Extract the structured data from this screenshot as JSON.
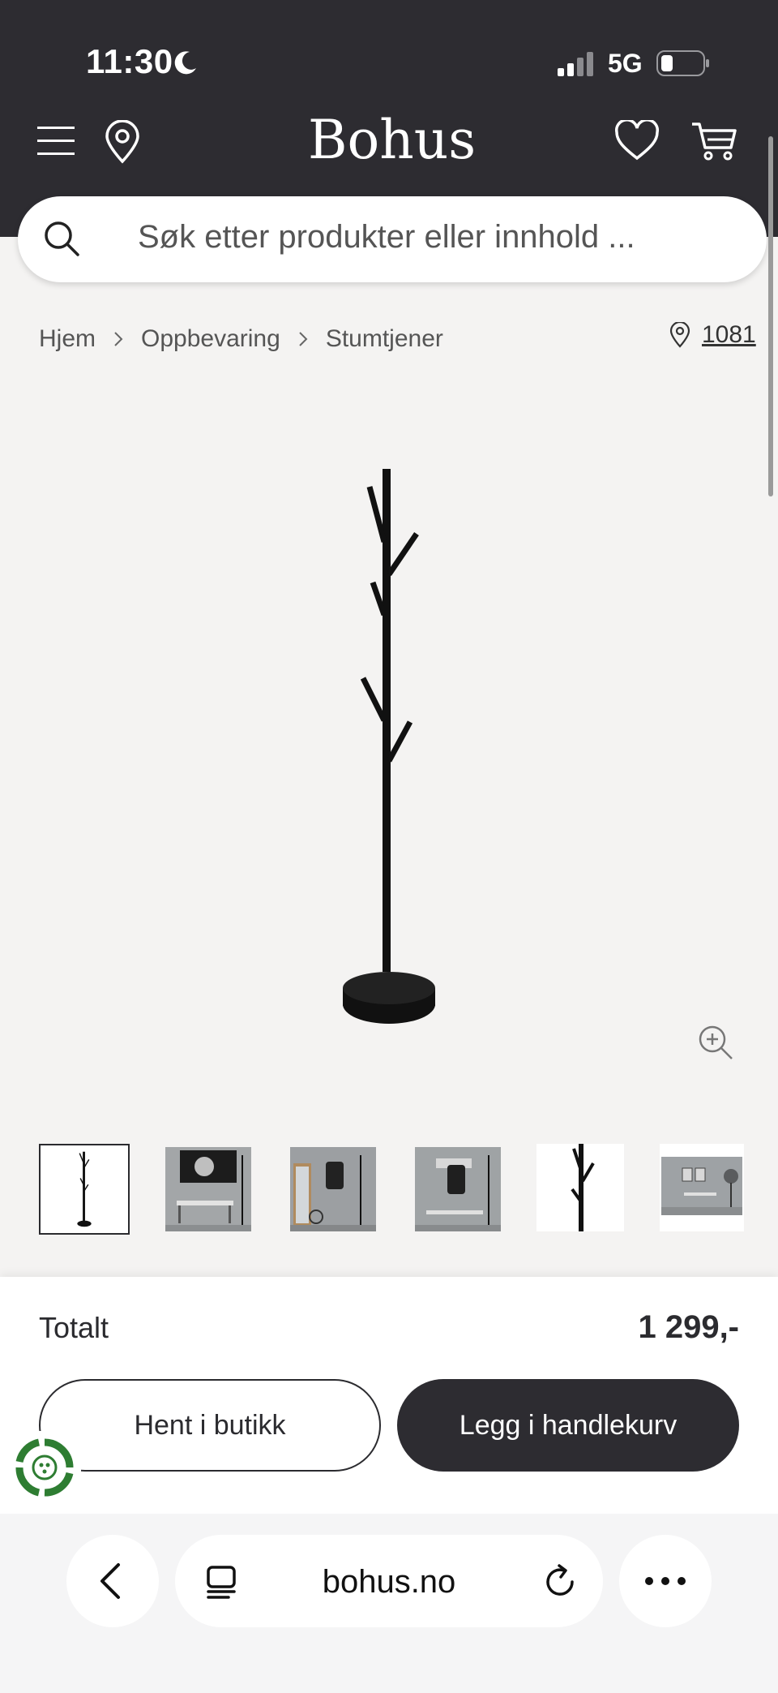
{
  "status_bar": {
    "time": "11:30",
    "network": "5G"
  },
  "header": {
    "logo": "Bohus",
    "search": {
      "placeholder": "Søk etter produkter eller innhold ..."
    }
  },
  "breadcrumb": {
    "items": [
      "Hjem",
      "Oppbevaring",
      "Stumtjener"
    ],
    "store_number": "1081"
  },
  "gallery": {
    "thumbnail_count": 6,
    "selected_index": 0
  },
  "purchase": {
    "total_label": "Totalt",
    "total_price": "1 299,-",
    "pickup_label": "Hent i butikk",
    "add_to_cart_label": "Legg i handlekurv"
  },
  "browser": {
    "url": "bohus.no"
  },
  "colors": {
    "header_bg": "#2d2c31",
    "page_bg": "#f4f3f2",
    "button_dark": "#2d2c31",
    "eco_green": "#2e7d32"
  },
  "icons": [
    "moon-icon",
    "signal-icon",
    "battery-icon",
    "menu-icon",
    "location-pin-icon",
    "heart-icon",
    "cart-icon",
    "search-icon",
    "chevron-right-icon",
    "zoom-in-icon",
    "eco-badge-icon",
    "back-icon",
    "tabs-icon",
    "reload-icon",
    "more-icon"
  ]
}
